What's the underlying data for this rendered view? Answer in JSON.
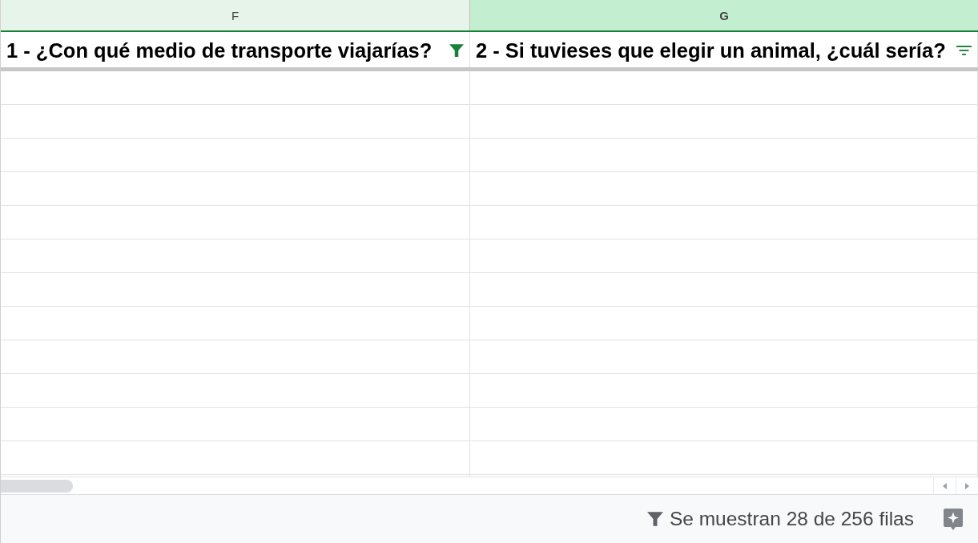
{
  "columns": [
    {
      "letter": "F",
      "selected": false,
      "header": "1 - ¿Con qué medio de transporte viajarías?",
      "filter_active": true
    },
    {
      "letter": "G",
      "selected": true,
      "header": "2 - Si tuvieses que elegir un animal, ¿cuál sería?",
      "filter_active": false
    }
  ],
  "status_bar": {
    "filter_summary": "Se muestran 28 de 256 filas"
  }
}
